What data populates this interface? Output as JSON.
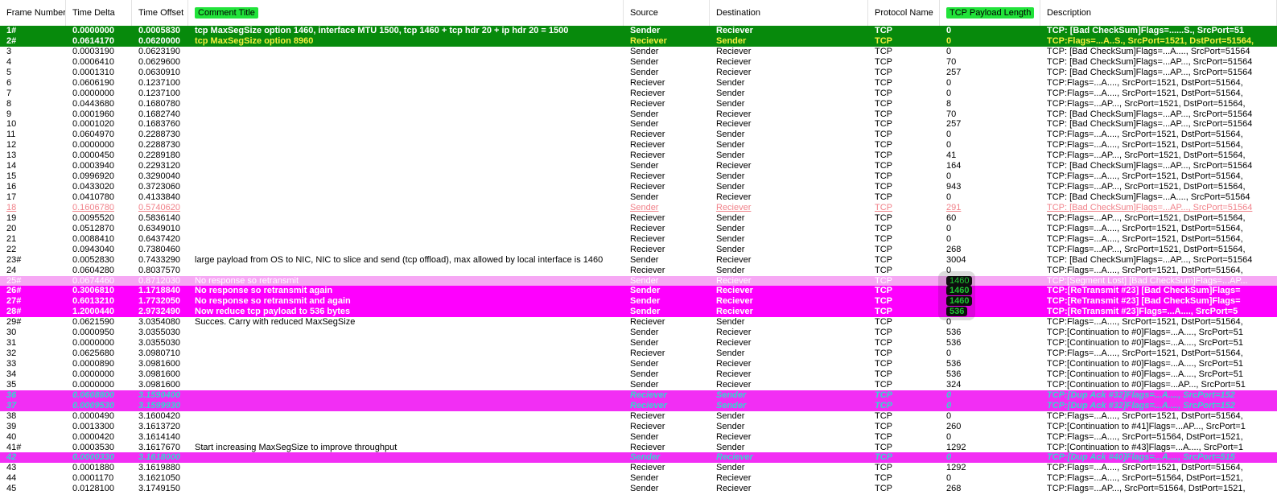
{
  "columns": [
    "Frame Number",
    "Time Delta",
    "Time Offset",
    "Comment Title",
    "Source",
    "Destination",
    "Protocol Name",
    "TCP Payload Length",
    "Description"
  ],
  "rows": [
    [
      "1#",
      "0.0000000",
      "0.0005830",
      "tcp MaxSegSize option 1460, interface MTU 1500, tcp 1460 + tcp hdr 20 + ip hdr 20 = 1500",
      "Sender",
      "Reciever",
      "TCP",
      "0",
      "TCP: [Bad CheckSum]Flags=......S., SrcPort=51"
    ],
    [
      "2#",
      "0.0614170",
      "0.0620000",
      "tcp MaxSegSize option 8960",
      "Reciever",
      "Sender",
      "TCP",
      "0",
      "TCP:Flags=...A..S., SrcPort=1521, DstPort=51564,"
    ],
    [
      "3",
      "0.0003190",
      "0.0623190",
      "",
      "Sender",
      "Reciever",
      "TCP",
      "0",
      "TCP: [Bad CheckSum]Flags=...A...., SrcPort=51564"
    ],
    [
      "4",
      "0.0006410",
      "0.0629600",
      "",
      "Sender",
      "Reciever",
      "TCP",
      "70",
      "TCP: [Bad CheckSum]Flags=...AP..., SrcPort=51564"
    ],
    [
      "5",
      "0.0001310",
      "0.0630910",
      "",
      "Sender",
      "Reciever",
      "TCP",
      "257",
      "TCP: [Bad CheckSum]Flags=...AP..., SrcPort=51564"
    ],
    [
      "6",
      "0.0606190",
      "0.1237100",
      "",
      "Reciever",
      "Sender",
      "TCP",
      "0",
      "TCP:Flags=...A...., SrcPort=1521, DstPort=51564,"
    ],
    [
      "7",
      "0.0000000",
      "0.1237100",
      "",
      "Reciever",
      "Sender",
      "TCP",
      "0",
      "TCP:Flags=...A...., SrcPort=1521, DstPort=51564,"
    ],
    [
      "8",
      "0.0443680",
      "0.1680780",
      "",
      "Reciever",
      "Sender",
      "TCP",
      "8",
      "TCP:Flags=...AP..., SrcPort=1521, DstPort=51564,"
    ],
    [
      "9",
      "0.0001960",
      "0.1682740",
      "",
      "Sender",
      "Reciever",
      "TCP",
      "70",
      "TCP: [Bad CheckSum]Flags=...AP..., SrcPort=51564"
    ],
    [
      "10",
      "0.0001020",
      "0.1683760",
      "",
      "Sender",
      "Reciever",
      "TCP",
      "257",
      "TCP: [Bad CheckSum]Flags=...AP..., SrcPort=51564"
    ],
    [
      "11",
      "0.0604970",
      "0.2288730",
      "",
      "Reciever",
      "Sender",
      "TCP",
      "0",
      "TCP:Flags=...A...., SrcPort=1521, DstPort=51564,"
    ],
    [
      "12",
      "0.0000000",
      "0.2288730",
      "",
      "Reciever",
      "Sender",
      "TCP",
      "0",
      "TCP:Flags=...A...., SrcPort=1521, DstPort=51564,"
    ],
    [
      "13",
      "0.0000450",
      "0.2289180",
      "",
      "Reciever",
      "Sender",
      "TCP",
      "41",
      "TCP:Flags=...AP..., SrcPort=1521, DstPort=51564,"
    ],
    [
      "14",
      "0.0003940",
      "0.2293120",
      "",
      "Sender",
      "Reciever",
      "TCP",
      "164",
      "TCP: [Bad CheckSum]Flags=...AP..., SrcPort=51564"
    ],
    [
      "15",
      "0.0996920",
      "0.3290040",
      "",
      "Reciever",
      "Sender",
      "TCP",
      "0",
      "TCP:Flags=...A...., SrcPort=1521, DstPort=51564,"
    ],
    [
      "16",
      "0.0433020",
      "0.3723060",
      "",
      "Reciever",
      "Sender",
      "TCP",
      "943",
      "TCP:Flags=...AP..., SrcPort=1521, DstPort=51564,"
    ],
    [
      "17",
      "0.0410780",
      "0.4133840",
      "",
      "Sender",
      "Reciever",
      "TCP",
      "0",
      "TCP: [Bad CheckSum]Flags=...A...., SrcPort=51564"
    ],
    [
      "18",
      "0.1606780",
      "0.5740620",
      "",
      "Sender",
      "Reciever",
      "TCP",
      "291",
      "TCP: [Bad CheckSum]Flags=...AP..., SrcPort=51564"
    ],
    [
      "19",
      "0.0095520",
      "0.5836140",
      "",
      "Reciever",
      "Sender",
      "TCP",
      "60",
      "TCP:Flags=...AP..., SrcPort=1521, DstPort=51564,"
    ],
    [
      "20",
      "0.0512870",
      "0.6349010",
      "",
      "Reciever",
      "Sender",
      "TCP",
      "0",
      "TCP:Flags=...A...., SrcPort=1521, DstPort=51564,"
    ],
    [
      "21",
      "0.0088410",
      "0.6437420",
      "",
      "Reciever",
      "Sender",
      "TCP",
      "0",
      "TCP:Flags=...A...., SrcPort=1521, DstPort=51564,"
    ],
    [
      "22",
      "0.0943040",
      "0.7380460",
      "",
      "Reciever",
      "Sender",
      "TCP",
      "268",
      "TCP:Flags=...AP..., SrcPort=1521, DstPort=51564,"
    ],
    [
      "23#",
      "0.0052830",
      "0.7433290",
      "large payload from OS to NIC, NIC to slice and send (tcp offload), max allowed by local interface is 1460",
      "Sender",
      "Reciever",
      "TCP",
      "3004",
      "TCP: [Bad CheckSum]Flags=...AP..., SrcPort=51564"
    ],
    [
      "24",
      "0.0604280",
      "0.8037570",
      "",
      "Reciever",
      "Sender",
      "TCP",
      "0",
      "TCP:Flags=...A...., SrcPort=1521, DstPort=51564,"
    ],
    [
      "25#",
      "0.0674460",
      "0.8712030",
      "No response so retransmit",
      "Sender",
      "Reciever",
      "TCP",
      "1460",
      "TCP:[Segment Lost] [Bad CheckSum]Flags=...AP..."
    ],
    [
      "26#",
      "0.3006810",
      "1.1718840",
      "No response so retransmit again",
      "Sender",
      "Reciever",
      "TCP",
      "1460",
      "TCP:[ReTransmit #23] [Bad CheckSum]Flags="
    ],
    [
      "27#",
      "0.6013210",
      "1.7732050",
      "No response so retransmit and again",
      "Sender",
      "Reciever",
      "TCP",
      "1460",
      "TCP:[ReTransmit #23] [Bad CheckSum]Flags="
    ],
    [
      "28#",
      "1.2000440",
      "2.9732490",
      "Now reduce tcp payload to 536 bytes",
      "Sender",
      "Reciever",
      "TCP",
      "536",
      "TCP:[ReTransmit #23]Flags=...A...., SrcPort=5"
    ],
    [
      "29#",
      "0.0621590",
      "3.0354080",
      "Succes. Carry with reduced MaxSegSize",
      "Reciever",
      "Sender",
      "TCP",
      "0",
      "TCP:Flags=...A...., SrcPort=1521, DstPort=51564,"
    ],
    [
      "30",
      "0.0000950",
      "3.0355030",
      "",
      "Sender",
      "Reciever",
      "TCP",
      "536",
      "TCP:[Continuation to #0]Flags=...A...., SrcPort=51"
    ],
    [
      "31",
      "0.0000000",
      "3.0355030",
      "",
      "Sender",
      "Reciever",
      "TCP",
      "536",
      "TCP:[Continuation to #0]Flags=...A...., SrcPort=51"
    ],
    [
      "32",
      "0.0625680",
      "3.0980710",
      "",
      "Reciever",
      "Sender",
      "TCP",
      "0",
      "TCP:Flags=...A...., SrcPort=1521, DstPort=51564,"
    ],
    [
      "33",
      "0.0000890",
      "3.0981600",
      "",
      "Sender",
      "Reciever",
      "TCP",
      "536",
      "TCP:[Continuation to #0]Flags=...A...., SrcPort=51"
    ],
    [
      "34",
      "0.0000000",
      "3.0981600",
      "",
      "Sender",
      "Reciever",
      "TCP",
      "536",
      "TCP:[Continuation to #0]Flags=...A...., SrcPort=51"
    ],
    [
      "35",
      "0.0000000",
      "3.0981600",
      "",
      "Sender",
      "Reciever",
      "TCP",
      "324",
      "TCP:[Continuation to #0]Flags=...AP..., SrcPort=51"
    ],
    [
      "36",
      "0.0608800",
      "3.1590400",
      "",
      "Reciever",
      "Sender",
      "TCP",
      "0",
      "TCP:[Dup Ack #32]Flags=...A...., SrcPort=152"
    ],
    [
      "37",
      "0.0009530",
      "3.1599930",
      "",
      "Reciever",
      "Sender",
      "TCP",
      "0",
      "TCP:[Dup Ack #32]Flags=...A...., SrcPort=152"
    ],
    [
      "38",
      "0.0000490",
      "3.1600420",
      "",
      "Reciever",
      "Sender",
      "TCP",
      "0",
      "TCP:Flags=...A...., SrcPort=1521, DstPort=51564,"
    ],
    [
      "39",
      "0.0013300",
      "3.1613720",
      "",
      "Reciever",
      "Sender",
      "TCP",
      "260",
      "TCP:[Continuation to #41]Flags=...AP..., SrcPort=1"
    ],
    [
      "40",
      "0.0000420",
      "3.1614140",
      "",
      "Sender",
      "Reciever",
      "TCP",
      "0",
      "TCP:Flags=...A...., SrcPort=51564, DstPort=1521,"
    ],
    [
      "41#",
      "0.0003530",
      "3.1617670",
      "Start increasing MaxSegSize to improve throughput",
      "Reciever",
      "Sender",
      "TCP",
      "1292",
      "TCP:[Continuation to #43]Flags=...A...., SrcPort=1"
    ],
    [
      "42",
      "0.0000330",
      "3.1618000",
      "",
      "Sender",
      "Reciever",
      "TCP",
      "0",
      "TCP:[Dup Ack #40]Flags=...A...., SrcPort=515"
    ],
    [
      "43",
      "0.0001880",
      "3.1619880",
      "",
      "Reciever",
      "Sender",
      "TCP",
      "1292",
      "TCP:Flags=...A...., SrcPort=1521, DstPort=51564,"
    ],
    [
      "44",
      "0.0001170",
      "3.1621050",
      "",
      "Sender",
      "Reciever",
      "TCP",
      "0",
      "TCP:Flags=...A...., SrcPort=51564, DstPort=1521,"
    ],
    [
      "45",
      "0.0128100",
      "3.1749150",
      "",
      "Sender",
      "Reciever",
      "TCP",
      "268",
      "TCP:Flags=...AP..., SrcPort=51564, DstPort=1521,"
    ]
  ],
  "row_styles": {
    "1#": "green",
    "2#": "green",
    "18": "faded",
    "25#": "lightpink",
    "26#": "pink",
    "27#": "pink",
    "28#": "pink",
    "36": "dup",
    "37": "dup",
    "42": "dup"
  },
  "highlighted_headers": [
    "Comment Title",
    "TCP Payload Length"
  ],
  "highlighted_payload_rows": [
    "25#",
    "26#",
    "27#",
    "28#"
  ],
  "colors": {
    "green_row": "#078a0c",
    "pink_row": "#fe00fe",
    "light_pink_row": "#f6a8f4",
    "dup_row": "#f22ef4",
    "dup_text": "#33d6d1",
    "header_highlight": "#21e33a",
    "faded_text": "#f1828a"
  }
}
